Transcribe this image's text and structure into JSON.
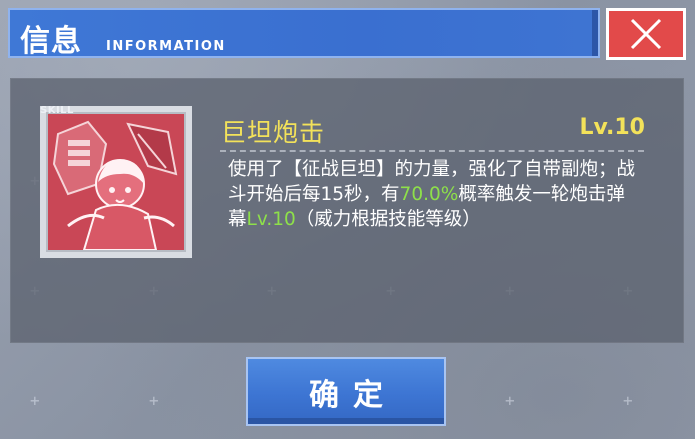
{
  "dialog": {
    "title": "信息",
    "subtitle": "INFORMATION",
    "close_icon": "close-icon"
  },
  "skill": {
    "tag": "SKILL",
    "name": "巨坦炮击",
    "level": "Lv.10",
    "desc_part1": "使用了【征战巨坦】的力量，强化了自带副炮；战斗开始后每15秒，有",
    "desc_chance": "70.0%",
    "desc_part2": "概率触发一轮炮击弹幕",
    "desc_level": "Lv.10",
    "desc_part3": "（威力根据技能等级）",
    "icon": "skill-portrait-icon"
  },
  "footer": {
    "confirm_label": "确定"
  },
  "colors": {
    "accent_blue": "#3f78d6",
    "close_red": "#e24a4a",
    "skill_yellow": "#f3e25a",
    "highlight_green": "#8ee04a",
    "icon_red": "#c94756"
  }
}
